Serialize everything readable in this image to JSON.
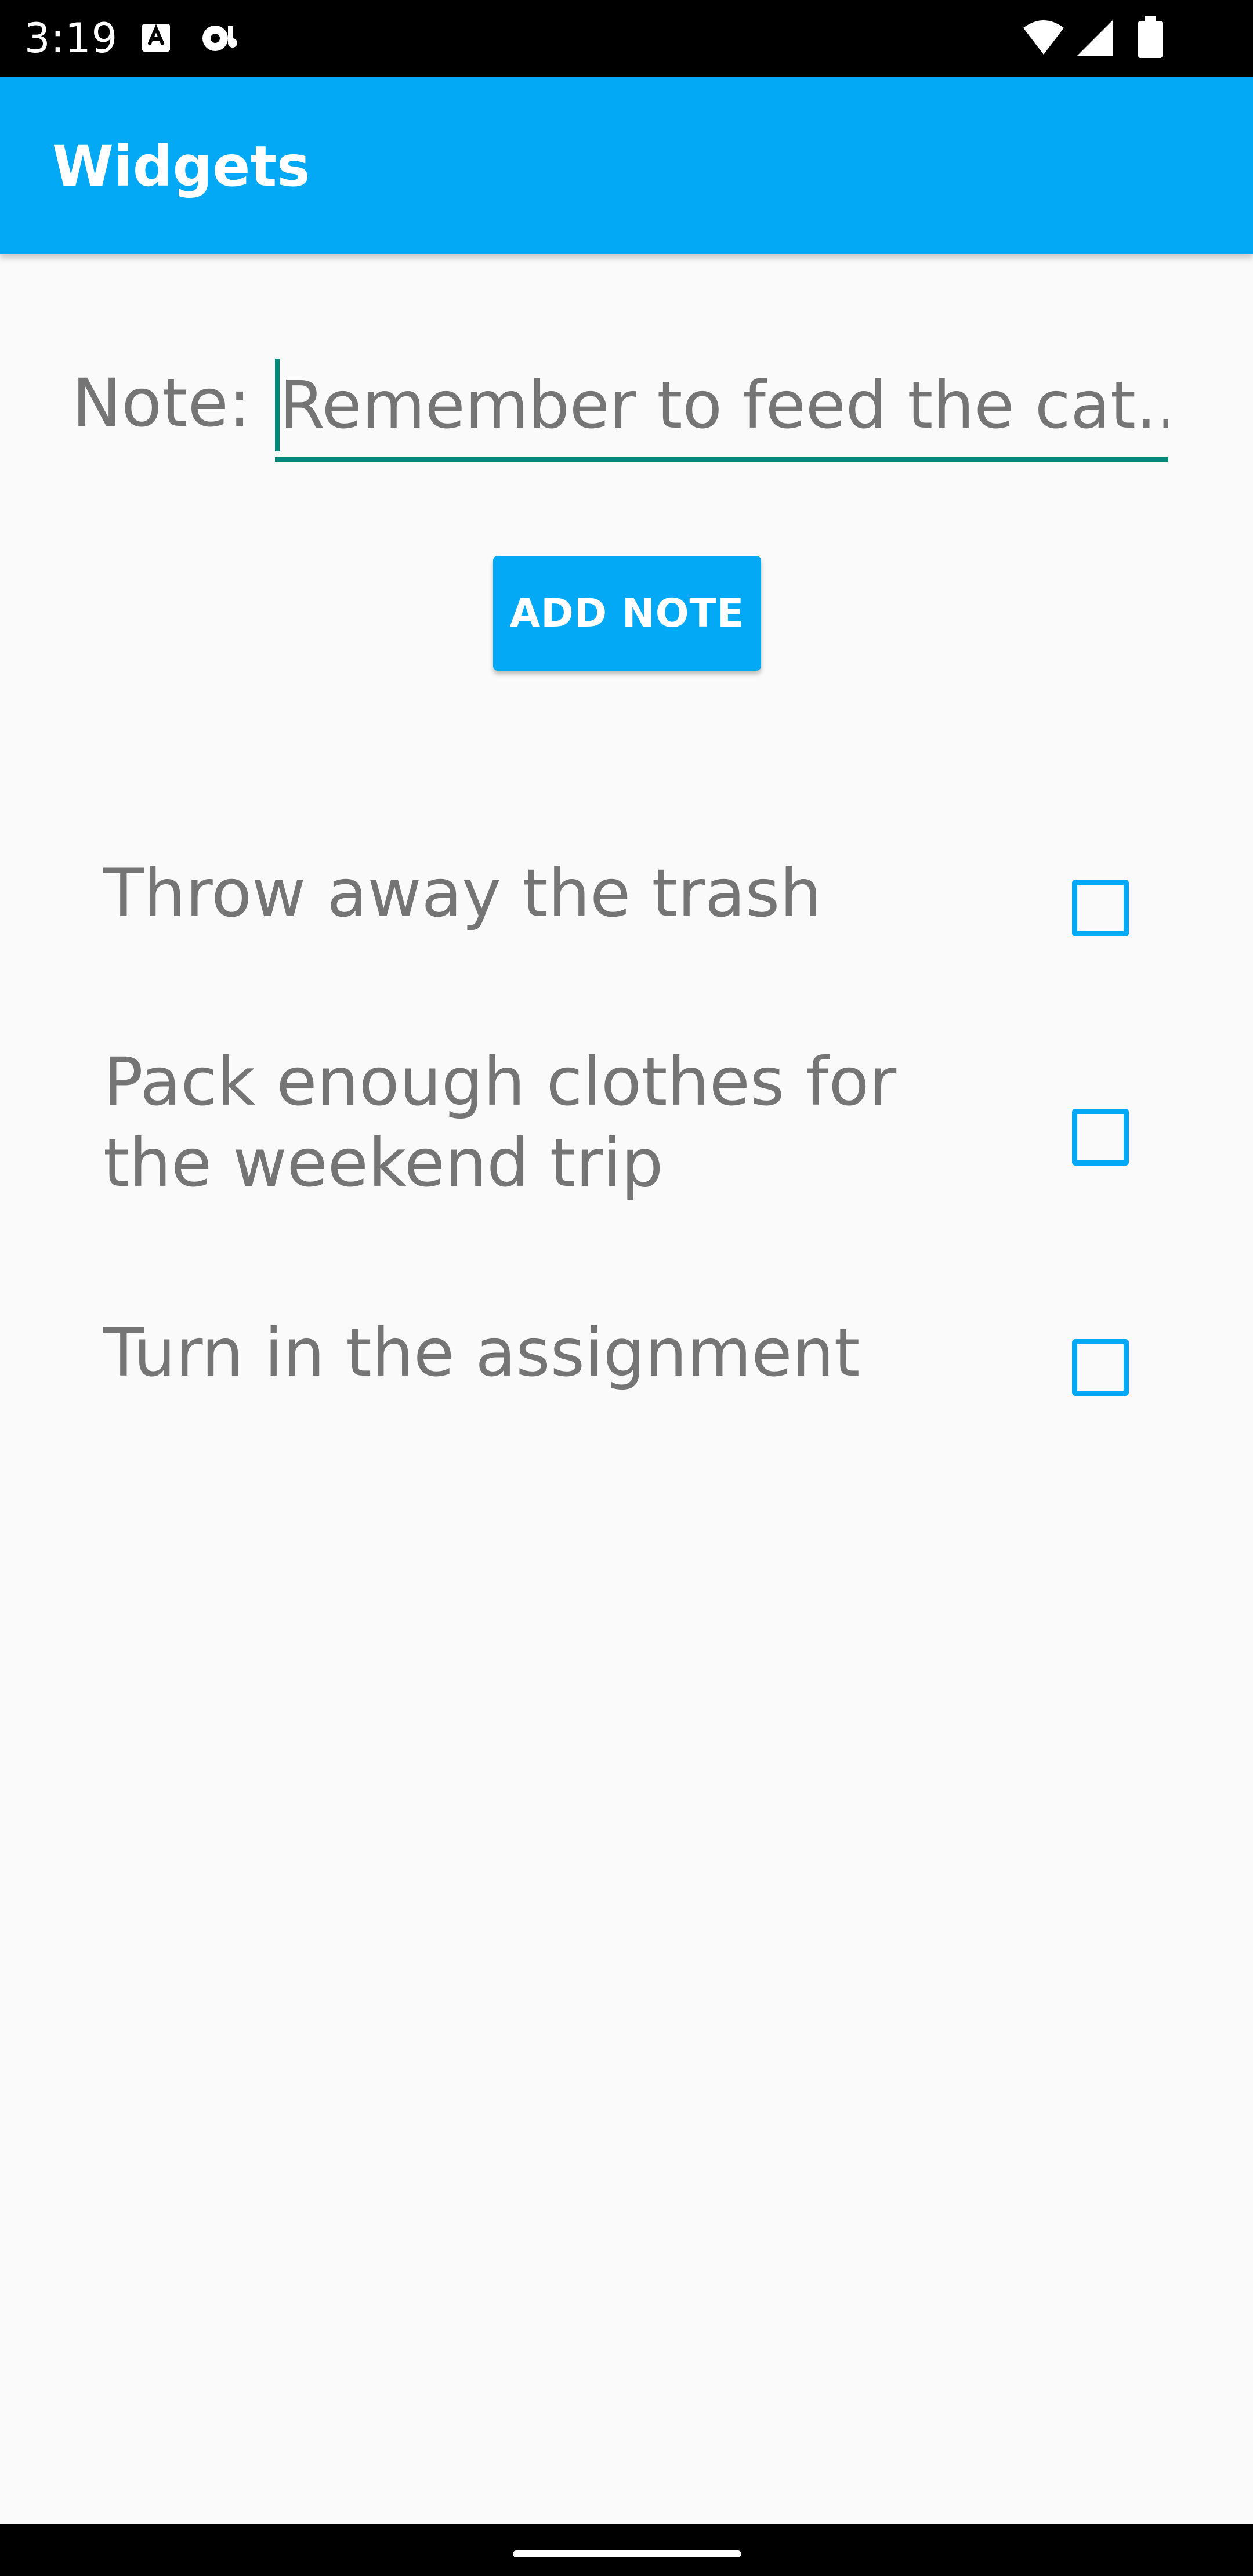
{
  "status_bar": {
    "time": "3:19",
    "icons": [
      "text-notification-icon",
      "media-notification-icon",
      "wifi-icon",
      "cell-signal-icon",
      "battery-icon"
    ]
  },
  "app_bar": {
    "title": "Widgets",
    "color": "#03a9f4"
  },
  "note_form": {
    "label": "Note:",
    "input_value": "",
    "input_placeholder": "Remember to feed the cat...",
    "underline_color": "#00897b",
    "add_button_label": "ADD NOTE"
  },
  "notes": [
    {
      "text": "Throw away the trash",
      "checked": false
    },
    {
      "text": "Pack enough clothes for the weekend trip",
      "checked": false
    },
    {
      "text": "Turn in the assignment",
      "checked": false
    }
  ],
  "colors": {
    "accent": "#03a9f4",
    "text_secondary": "#757575",
    "background": "#fafafa"
  }
}
